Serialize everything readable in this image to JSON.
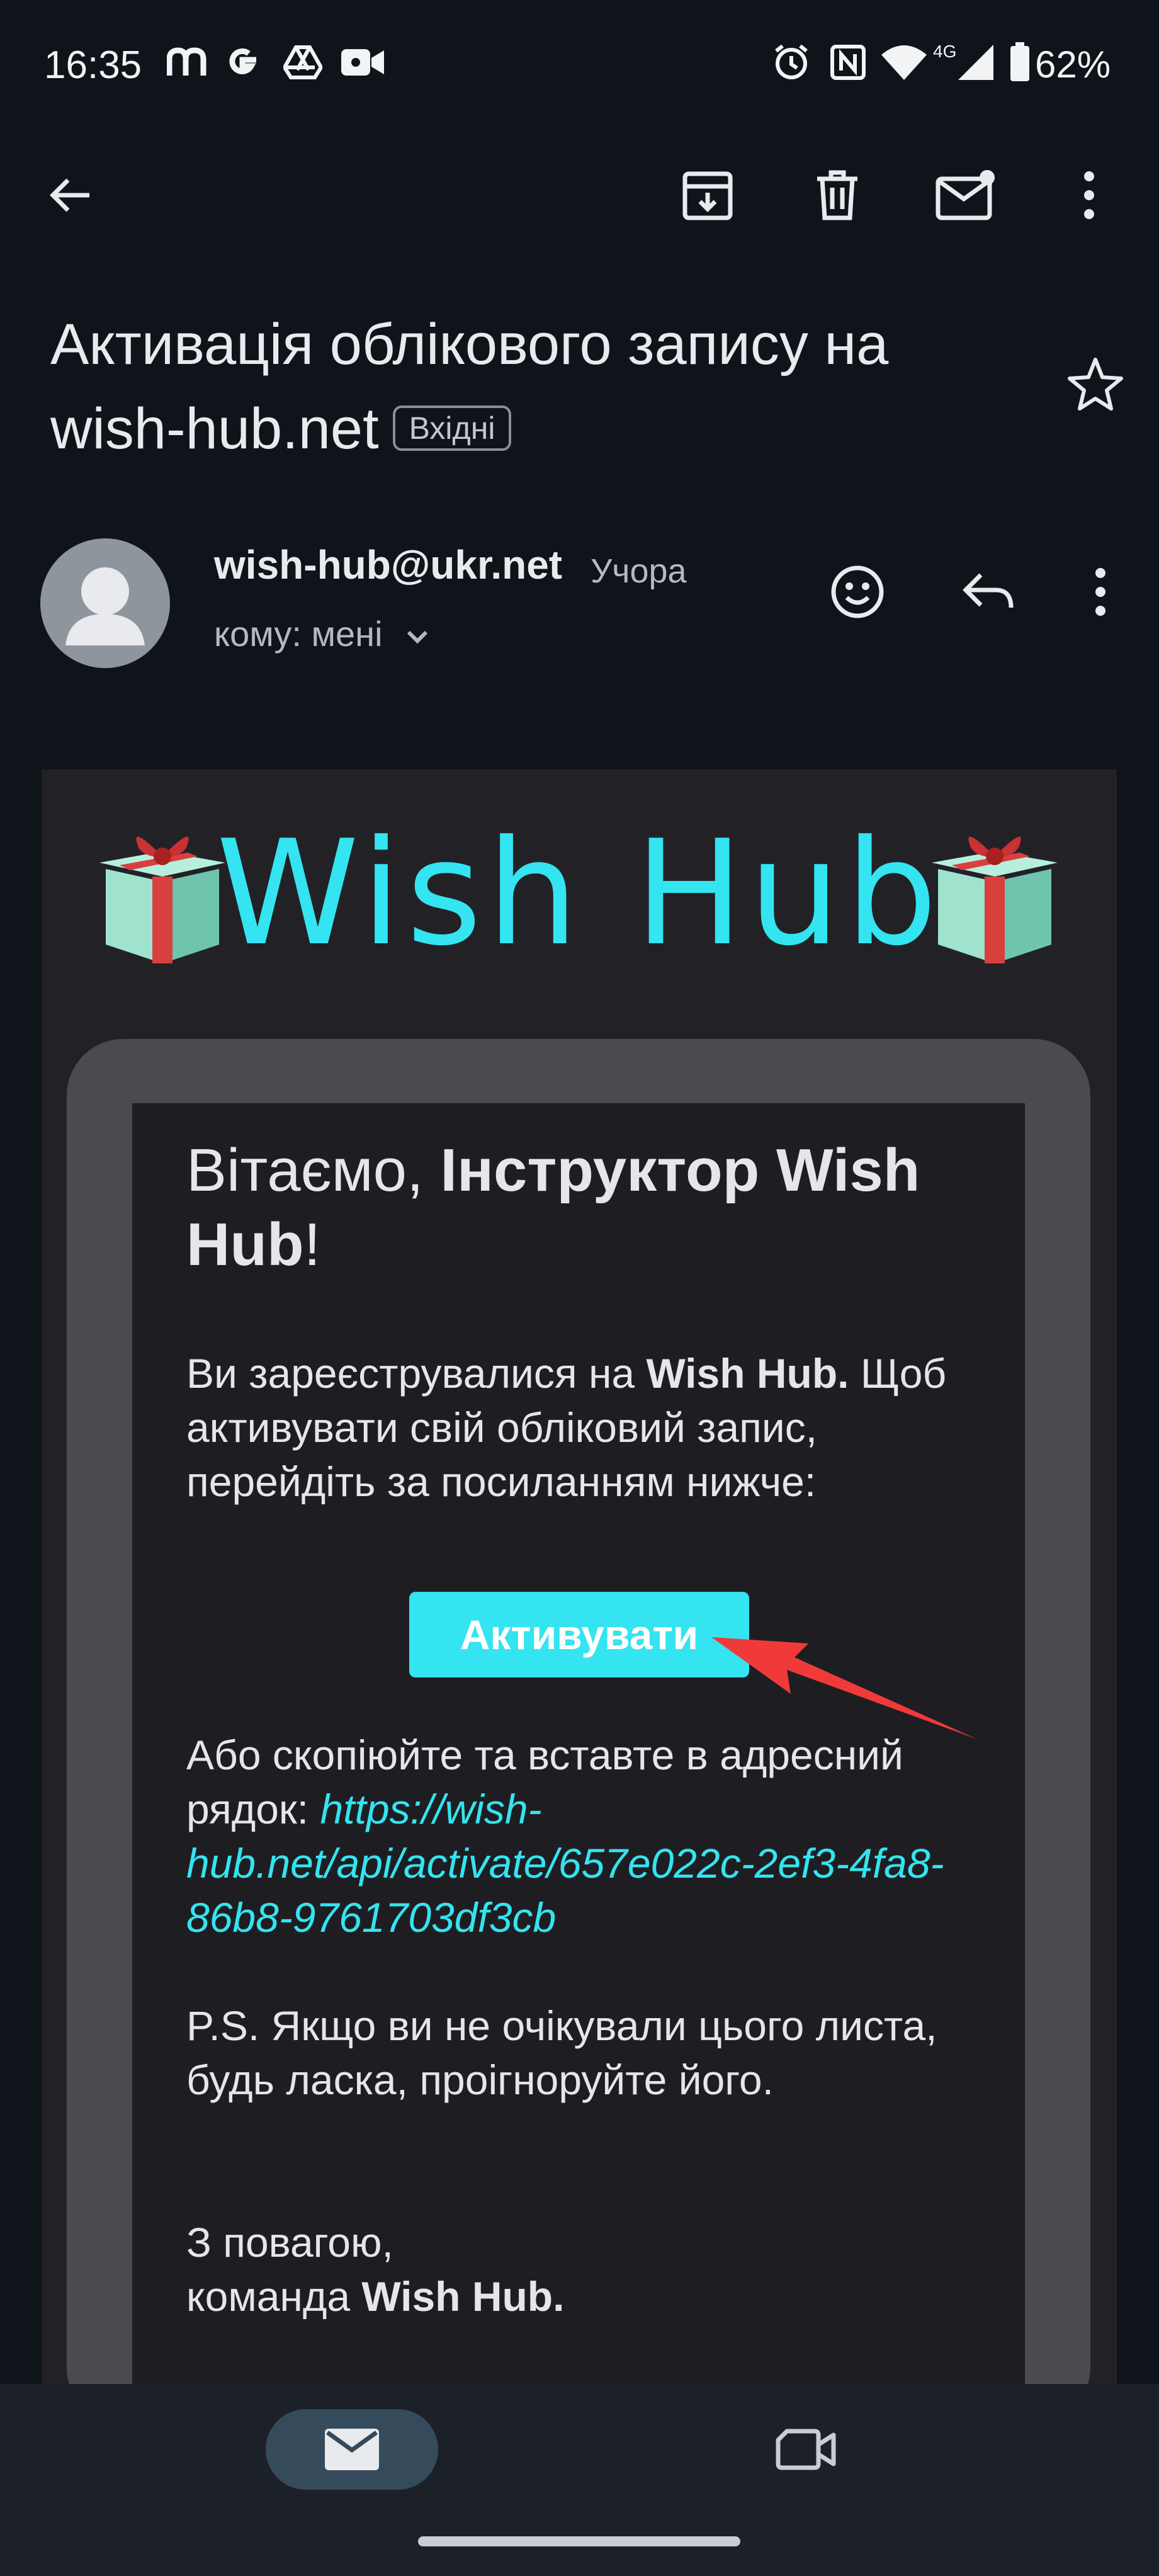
{
  "status_bar": {
    "time": "16:35",
    "battery": "62%",
    "network": "4G",
    "app_icons": [
      "m-icon",
      "google-icon",
      "drive-icon",
      "video-icon"
    ],
    "system_icons": [
      "alarm-icon",
      "nfc-icon",
      "wifi-icon",
      "signal-icon",
      "battery-icon"
    ]
  },
  "toolbar": {
    "back": "back-arrow-icon",
    "archive": "archive-icon",
    "delete": "trash-icon",
    "mark_unread": "mail-unread-icon",
    "more": "more-vert-icon"
  },
  "email": {
    "subject_line1": "Активація облікового запису на",
    "subject_line2": "wish-hub.net",
    "label": "Вхідні",
    "sender": "wish-hub@ukr.net",
    "time": "Учора",
    "recipient": "кому: мені"
  },
  "body": {
    "logo": "Wish Hub",
    "greeting_prefix": "Вітаємо, ",
    "greeting_name": "Інструктор Wish Hub",
    "greeting_suffix": "!",
    "registered_prefix": "Ви зареєструвалися на ",
    "registered_brand": "Wish Hub.",
    "registered_rest": " Щоб активувати свій обліковий запис, перейдіть за посиланням нижче:",
    "activate_button": "Активувати",
    "copy_text": "Або скопіюйте та вставте в адресний рядок: ",
    "activation_link": "https://wish-hub.net/api/activate/657e022c-2ef3-4fa8-86b8-9761703df3cb",
    "ps": "P.S. Якщо ви не очікували цього листа, будь ласка, проігноруйте його.",
    "regards_line1": "З повагою,",
    "regards_prefix": "команда ",
    "regards_brand": "Wish Hub."
  },
  "colors": {
    "accent": "#34e4f0",
    "background": "#0f141b",
    "arrow": "#f03a3a"
  }
}
